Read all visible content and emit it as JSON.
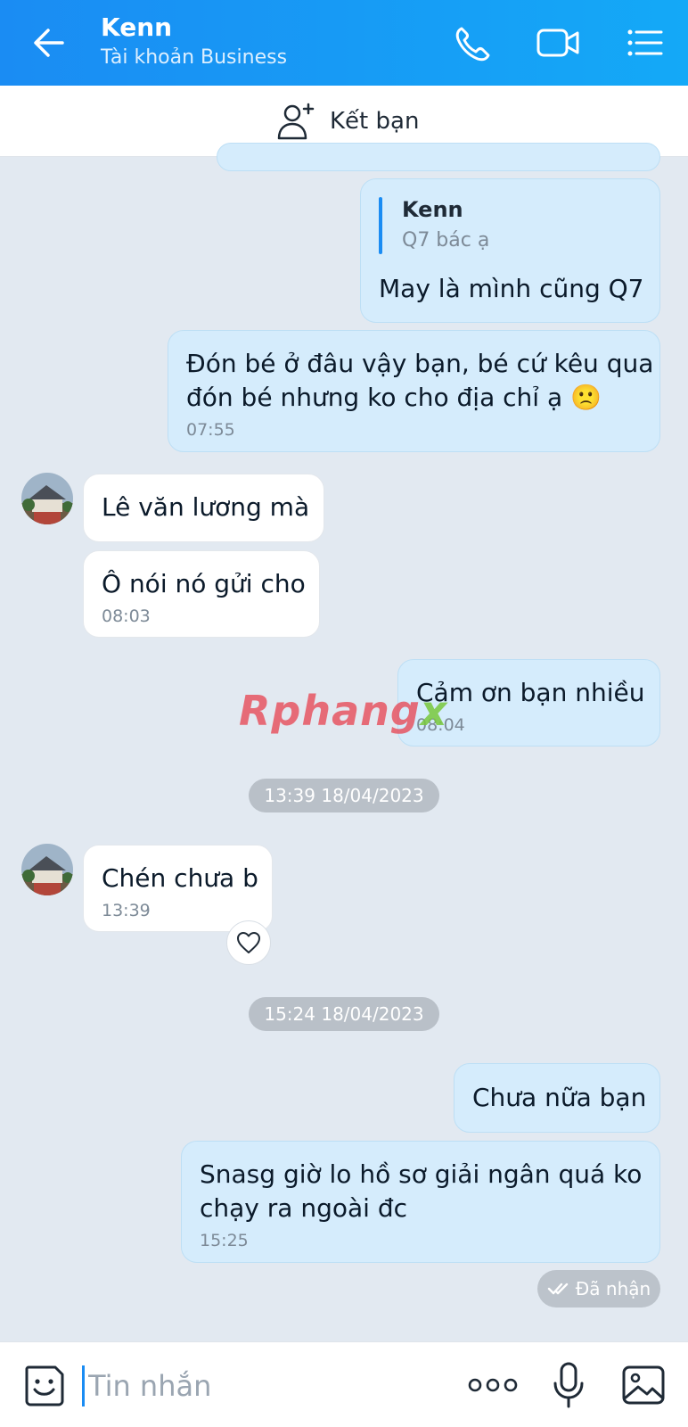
{
  "header": {
    "contact_name": "Kenn",
    "account_type": "Tài khoản Business",
    "background_color": "#1a8cf3"
  },
  "add_friend": {
    "label": "Kết bạn"
  },
  "messages": [
    {
      "direction": "sent",
      "quote": {
        "author": "Kenn",
        "text": "Q7 bác ạ"
      },
      "text": "May là mình cũng Q7"
    },
    {
      "direction": "sent",
      "lines": [
        "Đón bé ở đâu vậy bạn, bé cứ kêu qua",
        "đón bé nhưng ko cho địa chỉ ạ 🙁"
      ],
      "time": "07:55"
    },
    {
      "direction": "received",
      "text": "Lê văn lương mà"
    },
    {
      "direction": "received",
      "text": "Ô nói nó gửi cho",
      "time": "08:03"
    },
    {
      "direction": "sent",
      "text": "Cảm ơn bạn nhiều",
      "time": "08:04"
    },
    {
      "direction": "received",
      "text": "Chén chưa b",
      "time": "13:39"
    },
    {
      "direction": "sent",
      "text": "Chưa nữa bạn"
    },
    {
      "direction": "sent",
      "lines": [
        "Snasg giờ lo hồ sơ giải ngân quá ko",
        "chạy ra ngoài đc"
      ],
      "time": "15:25"
    }
  ],
  "date_separators": [
    "13:39 18/04/2023",
    "15:24 18/04/2023"
  ],
  "delivery_status": "Đã nhận",
  "watermark": {
    "main": "Rphang",
    "suffix": "x"
  },
  "input": {
    "placeholder": "Tin nhắn"
  },
  "colors": {
    "sent_bubble": "#d5ecfc",
    "received_bubble": "#ffffff",
    "chat_background": "#e2e9f1",
    "accent": "#1a8cf3"
  }
}
